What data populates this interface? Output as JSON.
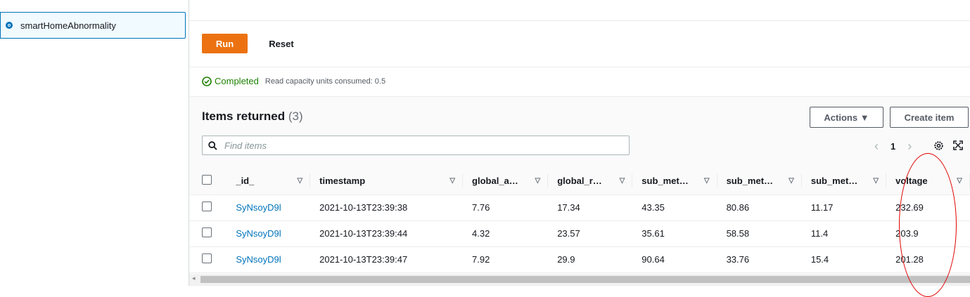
{
  "sidebar": {
    "selected_table": "smartHomeAbnormality"
  },
  "query": {
    "run_label": "Run",
    "reset_label": "Reset"
  },
  "status": {
    "label": "Completed",
    "detail": "Read capacity units consumed: 0.5",
    "color": "#1d8102"
  },
  "items": {
    "title": "Items returned",
    "count": "(3)",
    "actions_label": "Actions ▼",
    "create_label": "Create item",
    "search_placeholder": "Find items",
    "page": "1",
    "columns": [
      "_id_",
      "timestamp",
      "global_a…",
      "global_r…",
      "sub_met…",
      "sub_met…",
      "sub_met…",
      "voltage"
    ],
    "rows": [
      {
        "id": "SyNsoyD9l",
        "timestamp": "2021-10-13T23:39:38",
        "global_a": "7.76",
        "global_r": "17.34",
        "sub1": "43.35",
        "sub2": "80.86",
        "sub3": "11.17",
        "voltage": "232.69"
      },
      {
        "id": "SyNsoyD9l",
        "timestamp": "2021-10-13T23:39:44",
        "global_a": "4.32",
        "global_r": "23.57",
        "sub1": "35.61",
        "sub2": "58.58",
        "sub3": "11.4",
        "voltage": "203.9"
      },
      {
        "id": "SyNsoyD9l",
        "timestamp": "2021-10-13T23:39:47",
        "global_a": "7.92",
        "global_r": "29.9",
        "sub1": "90.64",
        "sub2": "33.76",
        "sub3": "15.4",
        "voltage": "201.28"
      }
    ]
  },
  "colors": {
    "accent": "#ec7211",
    "link": "#0073bb",
    "annotation": "#e00000"
  },
  "icons": [
    "check-circle-icon",
    "search-icon",
    "settings-icon",
    "expand-icon",
    "sort-caret-icon"
  ]
}
